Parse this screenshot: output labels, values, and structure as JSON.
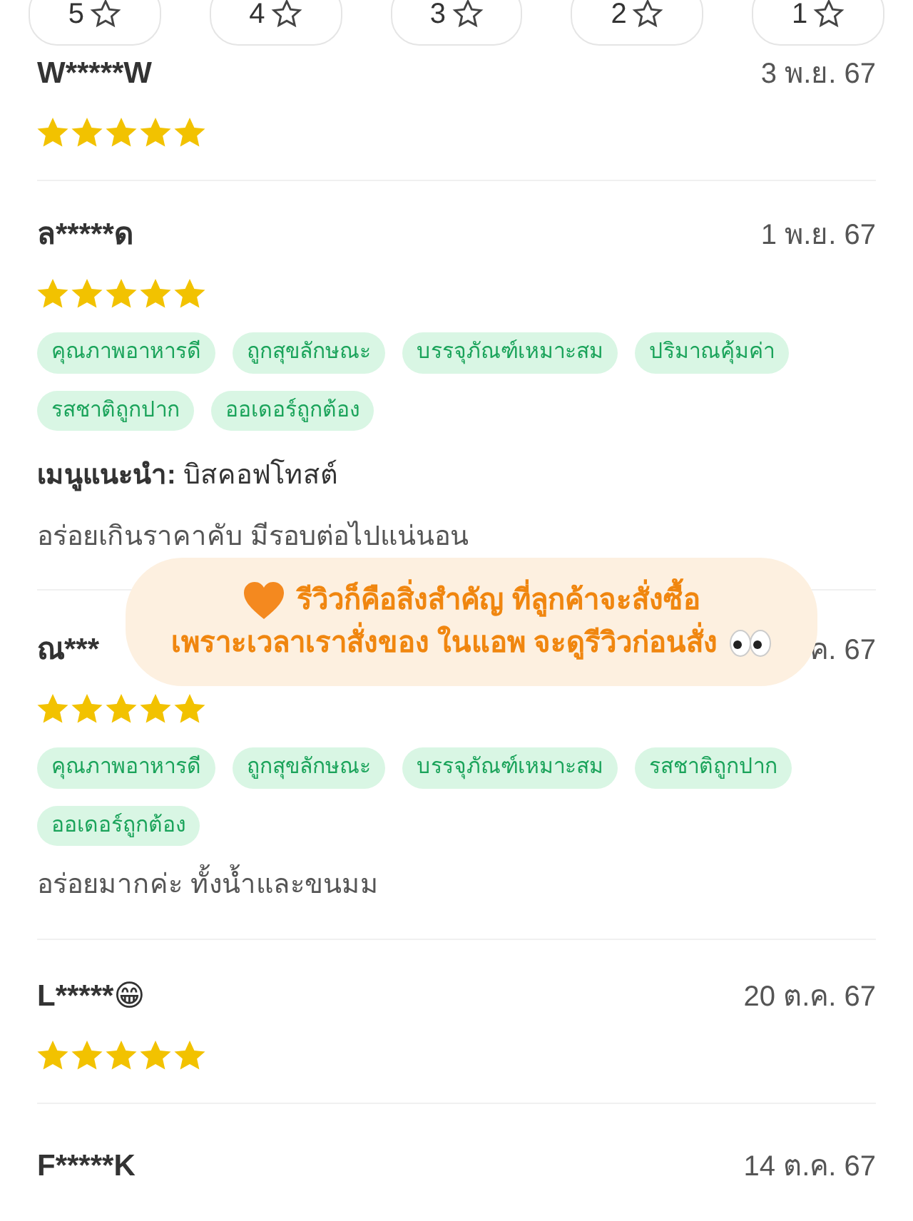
{
  "filter_chips": [
    {
      "label": "5",
      "selected": false
    },
    {
      "label": "4",
      "selected": false
    },
    {
      "label": "3",
      "selected": false
    },
    {
      "label": "2",
      "selected": false
    },
    {
      "label": "1",
      "selected": false
    }
  ],
  "reviews": [
    {
      "name": "W*****W",
      "date": "3 พ.ย. 67",
      "stars": 5
    },
    {
      "name": "ล*****ด",
      "date": "1 พ.ย. 67",
      "stars": 5,
      "tags": [
        "คุณภาพอาหารดี",
        "ถูกสุขลักษณะ",
        "บรรจุภัณฑ์เหมาะสม",
        "ปริมาณคุ้มค่า",
        "รสชาติถูกปาก",
        "ออเดอร์ถูกต้อง"
      ],
      "recommended": "**เมนูแนะนำ:** บิสคอฟโทสต์",
      "comment": "อร่อยเกินราคาคับ มีรอบต่อไปแน่นอน"
    },
    {
      "name": "ณ***",
      "date": "ค. 67",
      "stars": 5,
      "tags": [
        "คุณภาพอาหารดี",
        "ถูกสุขลักษณะ",
        "บรรจุภัณฑ์เหมาะสม",
        "รสชาติถูกปาก",
        "ออเดอร์ถูกต้อง"
      ],
      "comment": "อร่อยมากค่ะ ทั้งน้ำและขนมม"
    },
    {
      "name": "L*****😁",
      "date": "20 ต.ค. 67",
      "stars": 5
    },
    {
      "name": "F*****K",
      "date": "14 ต.ค. 67"
    }
  ],
  "caption": {
    "lines": [
      "รีวิวก็คือสิ่งสำคัญ ที่ลูกค้าจะสั่งซื้อ",
      "เพราะเวลาเราสั่งของ ในแอพ จะดูรีวิวก่อนสั่ง"
    ]
  }
}
